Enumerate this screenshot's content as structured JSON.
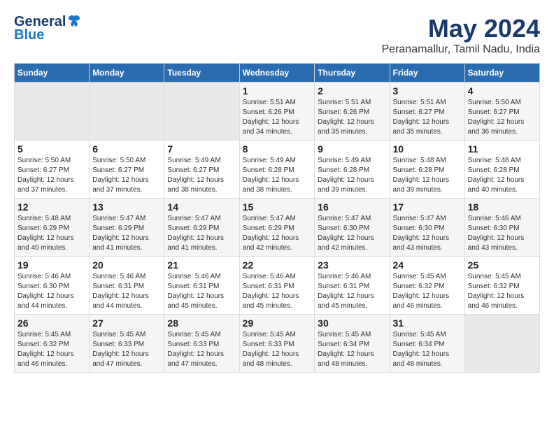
{
  "header": {
    "logo_general": "General",
    "logo_blue": "Blue",
    "title": "May 2024",
    "subtitle": "Peranamallur, Tamil Nadu, India"
  },
  "days_of_week": [
    "Sunday",
    "Monday",
    "Tuesday",
    "Wednesday",
    "Thursday",
    "Friday",
    "Saturday"
  ],
  "weeks": [
    {
      "days": [
        {
          "number": "",
          "sunrise": "",
          "sunset": "",
          "daylight": "",
          "empty": true
        },
        {
          "number": "",
          "sunrise": "",
          "sunset": "",
          "daylight": "",
          "empty": true
        },
        {
          "number": "",
          "sunrise": "",
          "sunset": "",
          "daylight": "",
          "empty": true
        },
        {
          "number": "1",
          "sunrise": "Sunrise: 5:51 AM",
          "sunset": "Sunset: 6:26 PM",
          "daylight": "Daylight: 12 hours and 34 minutes.",
          "empty": false
        },
        {
          "number": "2",
          "sunrise": "Sunrise: 5:51 AM",
          "sunset": "Sunset: 6:26 PM",
          "daylight": "Daylight: 12 hours and 35 minutes.",
          "empty": false
        },
        {
          "number": "3",
          "sunrise": "Sunrise: 5:51 AM",
          "sunset": "Sunset: 6:27 PM",
          "daylight": "Daylight: 12 hours and 35 minutes.",
          "empty": false
        },
        {
          "number": "4",
          "sunrise": "Sunrise: 5:50 AM",
          "sunset": "Sunset: 6:27 PM",
          "daylight": "Daylight: 12 hours and 36 minutes.",
          "empty": false
        }
      ]
    },
    {
      "days": [
        {
          "number": "5",
          "sunrise": "Sunrise: 5:50 AM",
          "sunset": "Sunset: 6:27 PM",
          "daylight": "Daylight: 12 hours and 37 minutes.",
          "empty": false
        },
        {
          "number": "6",
          "sunrise": "Sunrise: 5:50 AM",
          "sunset": "Sunset: 6:27 PM",
          "daylight": "Daylight: 12 hours and 37 minutes.",
          "empty": false
        },
        {
          "number": "7",
          "sunrise": "Sunrise: 5:49 AM",
          "sunset": "Sunset: 6:27 PM",
          "daylight": "Daylight: 12 hours and 38 minutes.",
          "empty": false
        },
        {
          "number": "8",
          "sunrise": "Sunrise: 5:49 AM",
          "sunset": "Sunset: 6:28 PM",
          "daylight": "Daylight: 12 hours and 38 minutes.",
          "empty": false
        },
        {
          "number": "9",
          "sunrise": "Sunrise: 5:49 AM",
          "sunset": "Sunset: 6:28 PM",
          "daylight": "Daylight: 12 hours and 39 minutes.",
          "empty": false
        },
        {
          "number": "10",
          "sunrise": "Sunrise: 5:48 AM",
          "sunset": "Sunset: 6:28 PM",
          "daylight": "Daylight: 12 hours and 39 minutes.",
          "empty": false
        },
        {
          "number": "11",
          "sunrise": "Sunrise: 5:48 AM",
          "sunset": "Sunset: 6:28 PM",
          "daylight": "Daylight: 12 hours and 40 minutes.",
          "empty": false
        }
      ]
    },
    {
      "days": [
        {
          "number": "12",
          "sunrise": "Sunrise: 5:48 AM",
          "sunset": "Sunset: 6:29 PM",
          "daylight": "Daylight: 12 hours and 40 minutes.",
          "empty": false
        },
        {
          "number": "13",
          "sunrise": "Sunrise: 5:47 AM",
          "sunset": "Sunset: 6:29 PM",
          "daylight": "Daylight: 12 hours and 41 minutes.",
          "empty": false
        },
        {
          "number": "14",
          "sunrise": "Sunrise: 5:47 AM",
          "sunset": "Sunset: 6:29 PM",
          "daylight": "Daylight: 12 hours and 41 minutes.",
          "empty": false
        },
        {
          "number": "15",
          "sunrise": "Sunrise: 5:47 AM",
          "sunset": "Sunset: 6:29 PM",
          "daylight": "Daylight: 12 hours and 42 minutes.",
          "empty": false
        },
        {
          "number": "16",
          "sunrise": "Sunrise: 5:47 AM",
          "sunset": "Sunset: 6:30 PM",
          "daylight": "Daylight: 12 hours and 42 minutes.",
          "empty": false
        },
        {
          "number": "17",
          "sunrise": "Sunrise: 5:47 AM",
          "sunset": "Sunset: 6:30 PM",
          "daylight": "Daylight: 12 hours and 43 minutes.",
          "empty": false
        },
        {
          "number": "18",
          "sunrise": "Sunrise: 5:46 AM",
          "sunset": "Sunset: 6:30 PM",
          "daylight": "Daylight: 12 hours and 43 minutes.",
          "empty": false
        }
      ]
    },
    {
      "days": [
        {
          "number": "19",
          "sunrise": "Sunrise: 5:46 AM",
          "sunset": "Sunset: 6:30 PM",
          "daylight": "Daylight: 12 hours and 44 minutes.",
          "empty": false
        },
        {
          "number": "20",
          "sunrise": "Sunrise: 5:46 AM",
          "sunset": "Sunset: 6:31 PM",
          "daylight": "Daylight: 12 hours and 44 minutes.",
          "empty": false
        },
        {
          "number": "21",
          "sunrise": "Sunrise: 5:46 AM",
          "sunset": "Sunset: 6:31 PM",
          "daylight": "Daylight: 12 hours and 45 minutes.",
          "empty": false
        },
        {
          "number": "22",
          "sunrise": "Sunrise: 5:46 AM",
          "sunset": "Sunset: 6:31 PM",
          "daylight": "Daylight: 12 hours and 45 minutes.",
          "empty": false
        },
        {
          "number": "23",
          "sunrise": "Sunrise: 5:46 AM",
          "sunset": "Sunset: 6:31 PM",
          "daylight": "Daylight: 12 hours and 45 minutes.",
          "empty": false
        },
        {
          "number": "24",
          "sunrise": "Sunrise: 5:45 AM",
          "sunset": "Sunset: 6:32 PM",
          "daylight": "Daylight: 12 hours and 46 minutes.",
          "empty": false
        },
        {
          "number": "25",
          "sunrise": "Sunrise: 5:45 AM",
          "sunset": "Sunset: 6:32 PM",
          "daylight": "Daylight: 12 hours and 46 minutes.",
          "empty": false
        }
      ]
    },
    {
      "days": [
        {
          "number": "26",
          "sunrise": "Sunrise: 5:45 AM",
          "sunset": "Sunset: 6:32 PM",
          "daylight": "Daylight: 12 hours and 46 minutes.",
          "empty": false
        },
        {
          "number": "27",
          "sunrise": "Sunrise: 5:45 AM",
          "sunset": "Sunset: 6:33 PM",
          "daylight": "Daylight: 12 hours and 47 minutes.",
          "empty": false
        },
        {
          "number": "28",
          "sunrise": "Sunrise: 5:45 AM",
          "sunset": "Sunset: 6:33 PM",
          "daylight": "Daylight: 12 hours and 47 minutes.",
          "empty": false
        },
        {
          "number": "29",
          "sunrise": "Sunrise: 5:45 AM",
          "sunset": "Sunset: 6:33 PM",
          "daylight": "Daylight: 12 hours and 48 minutes.",
          "empty": false
        },
        {
          "number": "30",
          "sunrise": "Sunrise: 5:45 AM",
          "sunset": "Sunset: 6:34 PM",
          "daylight": "Daylight: 12 hours and 48 minutes.",
          "empty": false
        },
        {
          "number": "31",
          "sunrise": "Sunrise: 5:45 AM",
          "sunset": "Sunset: 6:34 PM",
          "daylight": "Daylight: 12 hours and 48 minutes.",
          "empty": false
        },
        {
          "number": "",
          "sunrise": "",
          "sunset": "",
          "daylight": "",
          "empty": true
        }
      ]
    }
  ]
}
